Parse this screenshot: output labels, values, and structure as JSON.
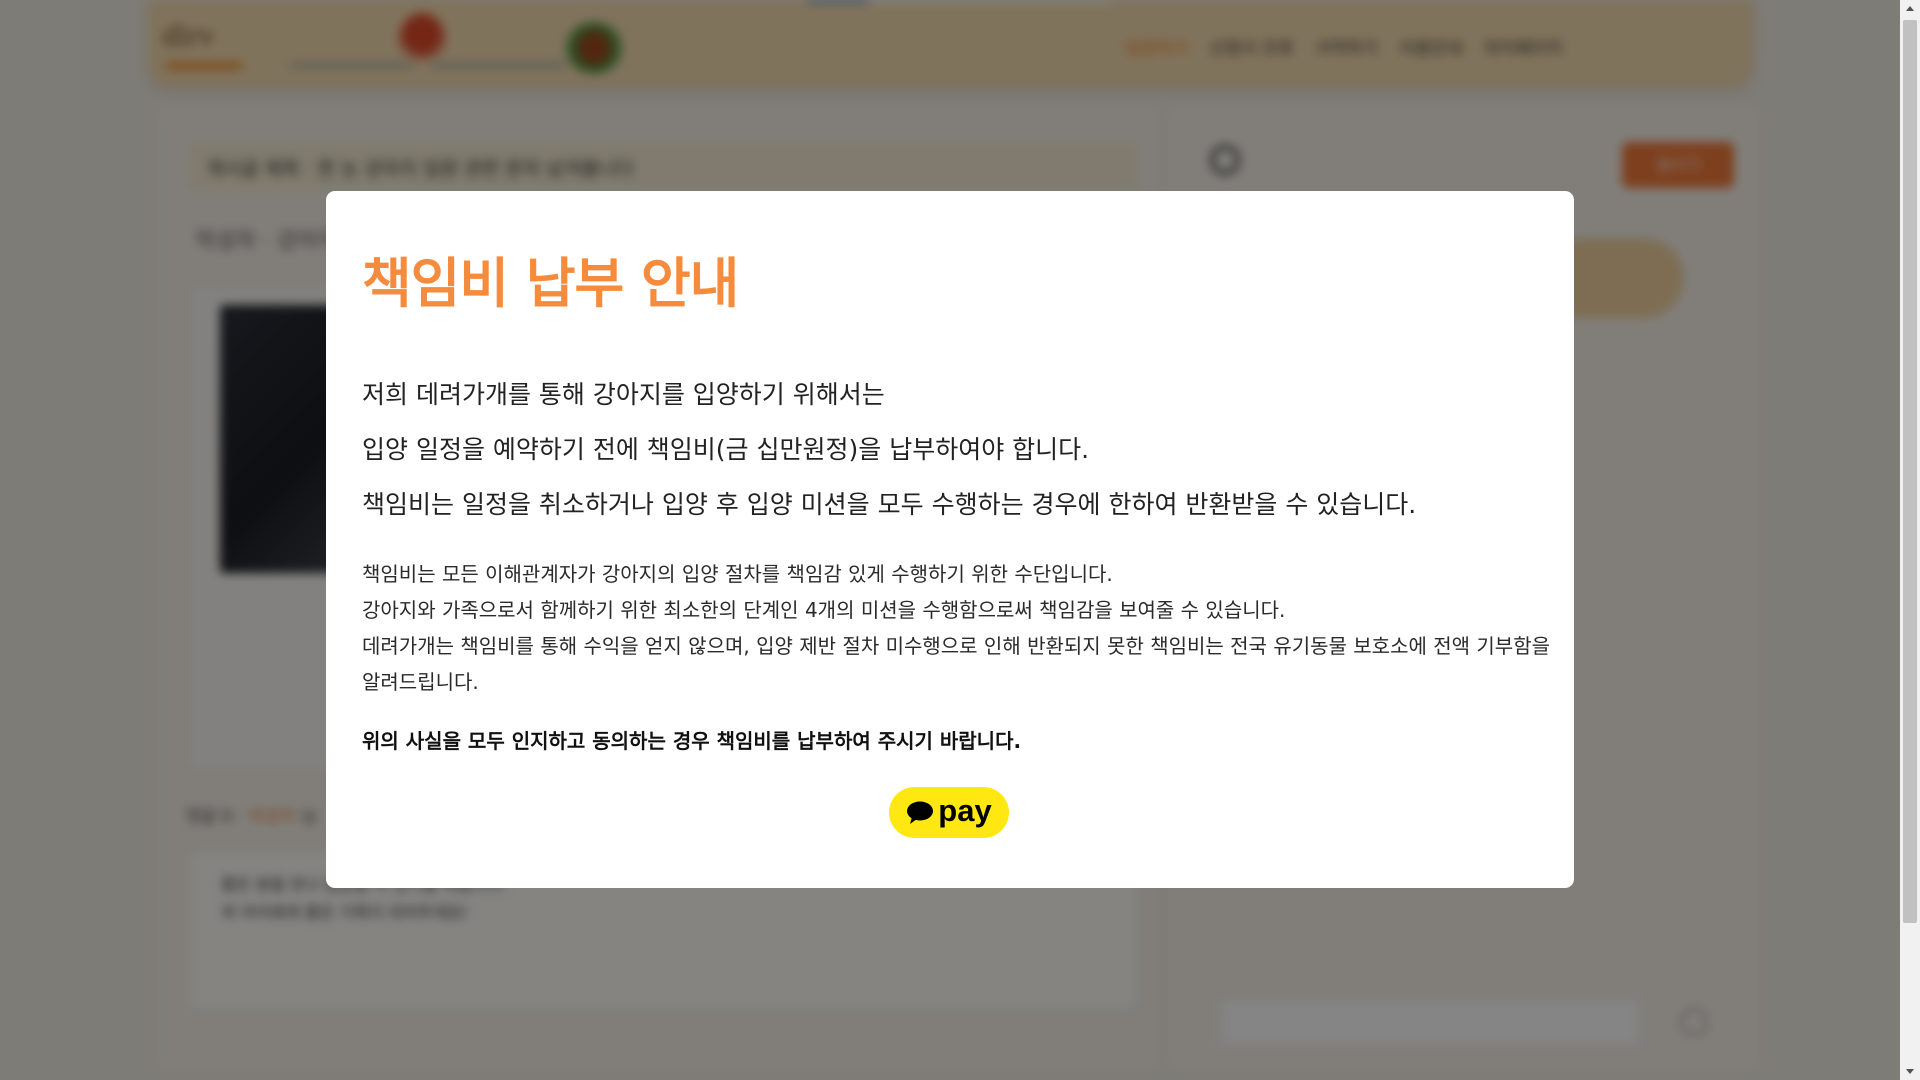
{
  "background": {
    "nav": {
      "items": [
        "입양하기",
        "신청서 조회",
        "서약하기",
        "이용안내",
        "마이페이지"
      ],
      "active_index": 0
    },
    "question_bar_text": "게시글 제목 · 한 눈 강아지 입양 관련 문의 남겨봅니다",
    "sub_line_text": "작성자 · 강아지",
    "comment_meta": {
      "prefix": "댓글 0 ·",
      "highlight": "작성자",
      "suffix": "님"
    },
    "comment_lines": [
      "좋은 분을 만나 입양할 수 있기를 바랍니다.",
      "꼭 아이에게 좋은 가족이 되어주세요!"
    ],
    "write_button_label": "글쓰기",
    "top_progress": 0.2,
    "colors": {
      "header": "#f6dcb0",
      "accent": "#f07a1a"
    }
  },
  "modal": {
    "title": "책임비 납부 안내",
    "lead": [
      "저희 데려가개를 통해 강아지를 입양하기 위해서는",
      "입양 일정을 예약하기 전에 책임비(금 십만원정)을 납부하여야 합니다.",
      "책임비는 일정을 취소하거나 입양 후 입양 미션을 모두 수행하는 경우에 한하여 반환받을 수 있습니다."
    ],
    "body": [
      "책임비는 모든 이해관계자가 강아지의 입양 절차를 책임감 있게 수행하기 위한 수단입니다.",
      "강아지와 가족으로서 함께하기 위한 최소한의 단계인 4개의 미션을 수행함으로써 책임감을 보여줄 수 있습니다.",
      "데려가개는 책임비를 통해 수익을 얻지 않으며, 입양 제반 절차 미수행으로 인해 반환되지 못한 책임비는 전국 유기동물 보호소에 전액 기부함을 알려드립니다."
    ],
    "emphasis": "위의 사실을 모두 인지하고 동의하는 경우 책임비를 납부하여 주시기 바랍니다.",
    "pay_button": {
      "label": "pay",
      "icon": "speech-bubble-icon",
      "color": "#ffe812"
    },
    "colors": {
      "title": "#f58b3d"
    }
  }
}
